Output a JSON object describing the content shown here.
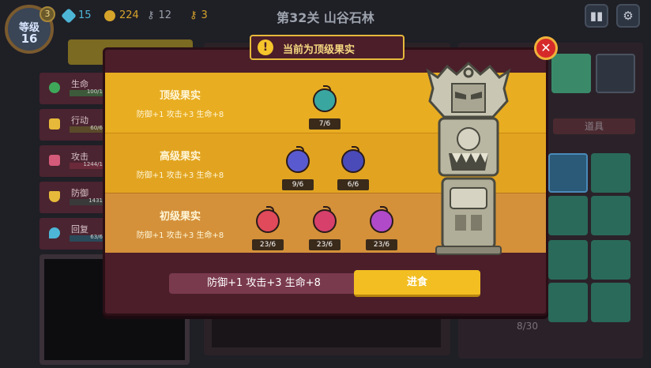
{
  "level": {
    "label": "等级",
    "value": "16",
    "badge": "3"
  },
  "resources": [
    {
      "icon": "gem-icon",
      "value": "15",
      "color": "#4db6d6"
    },
    {
      "icon": "coin-icon",
      "value": "224",
      "color": "#d6a42a"
    },
    {
      "icon": "key-icon",
      "value": "12",
      "color": "#9aa0aa"
    },
    {
      "icon": "gold-key-icon",
      "value": "3",
      "color": "#d6a42a"
    }
  ],
  "stage_title": "第32关 山谷石林",
  "stats": [
    {
      "name": "生命",
      "value": "100/1",
      "color": "#3fa75a"
    },
    {
      "name": "行动",
      "value": "60/6",
      "color": "#e6b93a"
    },
    {
      "name": "攻击",
      "value": "1244/1",
      "color": "#d65a7a"
    },
    {
      "name": "防御",
      "value": "1431",
      "color": "#e6b93a"
    },
    {
      "name": "回复",
      "value": "63/6",
      "color": "#4db6d6"
    }
  ],
  "right_panel": {
    "tab_label": "道具",
    "page_count": "8/30"
  },
  "modal": {
    "title": "当前为顶级果实",
    "tiers": [
      {
        "name": "顶级果实",
        "bonus": "防御+1 攻击+3 生命+8",
        "fruits": [
          {
            "count": "7/6",
            "color": "#3aa6a0"
          }
        ]
      },
      {
        "name": "高级果实",
        "bonus": "防御+1 攻击+3 生命+8",
        "fruits": [
          {
            "count": "9/6",
            "color": "#5a5ad0"
          },
          {
            "count": "6/6",
            "color": "#4a4ab8"
          }
        ]
      },
      {
        "name": "初级果实",
        "bonus": "防御+1 攻击+3 生命+8",
        "fruits": [
          {
            "count": "23/6",
            "color": "#e04a5a"
          },
          {
            "count": "23/6",
            "color": "#d6406a"
          },
          {
            "count": "23/6",
            "color": "#b04ac8"
          }
        ]
      }
    ],
    "summary": "防御+1 攻击+3 生命+8",
    "eat_button": "进食"
  }
}
